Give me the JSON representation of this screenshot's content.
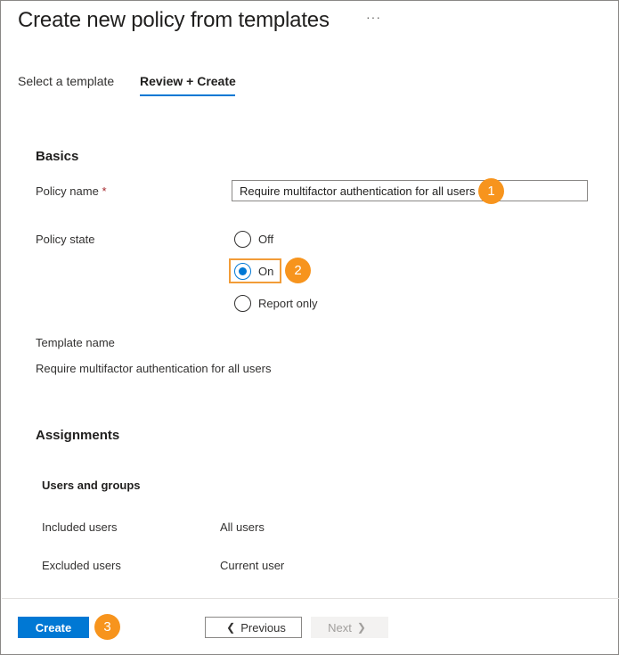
{
  "header": {
    "title": "Create new policy from templates",
    "more": "···"
  },
  "tabs": [
    {
      "label": "Select a template"
    },
    {
      "label": "Review + Create"
    }
  ],
  "basics": {
    "heading": "Basics",
    "policy_name_label": "Policy name",
    "required_mark": "*",
    "policy_name_value": "Require multifactor authentication for all users",
    "policy_state_label": "Policy state",
    "options": [
      {
        "label": "Off",
        "checked": false
      },
      {
        "label": "On",
        "checked": true
      },
      {
        "label": "Report only",
        "checked": false
      }
    ],
    "template_name_label": "Template name",
    "template_name_value": "Require multifactor authentication for all users"
  },
  "assignments": {
    "heading": "Assignments",
    "users_groups_heading": "Users and groups",
    "included_label": "Included users",
    "included_value": "All users",
    "excluded_label": "Excluded users",
    "excluded_value": "Current user"
  },
  "footer": {
    "create_label": "Create",
    "previous_label": "Previous",
    "next_label": "Next"
  },
  "callouts": [
    "1",
    "2",
    "3"
  ],
  "colors": {
    "accent": "#0078d4",
    "callout": "#f7941d",
    "highlight": "#f29c38",
    "required": "#a4262c"
  }
}
